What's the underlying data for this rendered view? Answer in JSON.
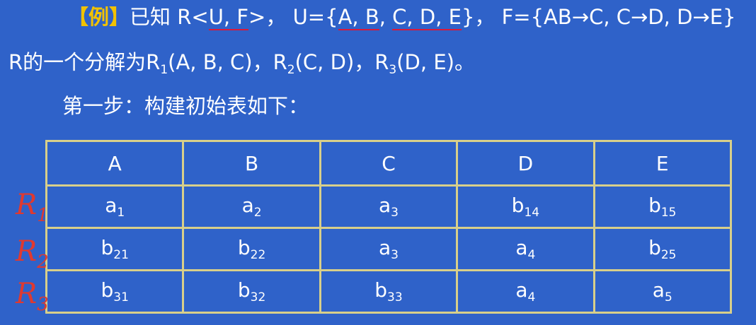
{
  "line1": {
    "tag": "【例】",
    "known": "已知 R",
    "lt": "<",
    "uf": "U, F",
    "gt": ">，",
    "u_eq": "U={",
    "u_set1": "A, B",
    "comma": ", ",
    "u_set2": "C, D, E",
    "u_close": "}，",
    "f": "F={AB→C, C→D, D→E}"
  },
  "line2": {
    "p0": "R的一个分解为R",
    "s1": "1",
    "p1": "(A, B, C)，R",
    "s2": "2",
    "p2": "(C, D)，R",
    "s3": "3",
    "p3": "(D, E)。"
  },
  "line3": "第一步：构建初始表如下：",
  "table": {
    "headers": [
      "A",
      "B",
      "C",
      "D",
      "E"
    ],
    "rows": [
      [
        [
          "a",
          "1"
        ],
        [
          "a",
          "2"
        ],
        [
          "a",
          "3"
        ],
        [
          "b",
          "14"
        ],
        [
          "b",
          "15"
        ]
      ],
      [
        [
          "b",
          "21"
        ],
        [
          "b",
          "22"
        ],
        [
          "a",
          "3"
        ],
        [
          "a",
          "4"
        ],
        [
          "b",
          "25"
        ]
      ],
      [
        [
          "b",
          "31"
        ],
        [
          "b",
          "32"
        ],
        [
          "b",
          "33"
        ],
        [
          "a",
          "4"
        ],
        [
          "a",
          "5"
        ]
      ]
    ]
  },
  "annotations": [
    {
      "letter": "R",
      "sub": "1"
    },
    {
      "letter": "R",
      "sub": "2"
    },
    {
      "letter": "R",
      "sub": "3"
    }
  ],
  "colors": {
    "background": "#2f62c9",
    "tag": "#f2c200",
    "underline": "#d8193a",
    "table_border": "#d8cf8a",
    "handwriting": "#e0392f"
  }
}
